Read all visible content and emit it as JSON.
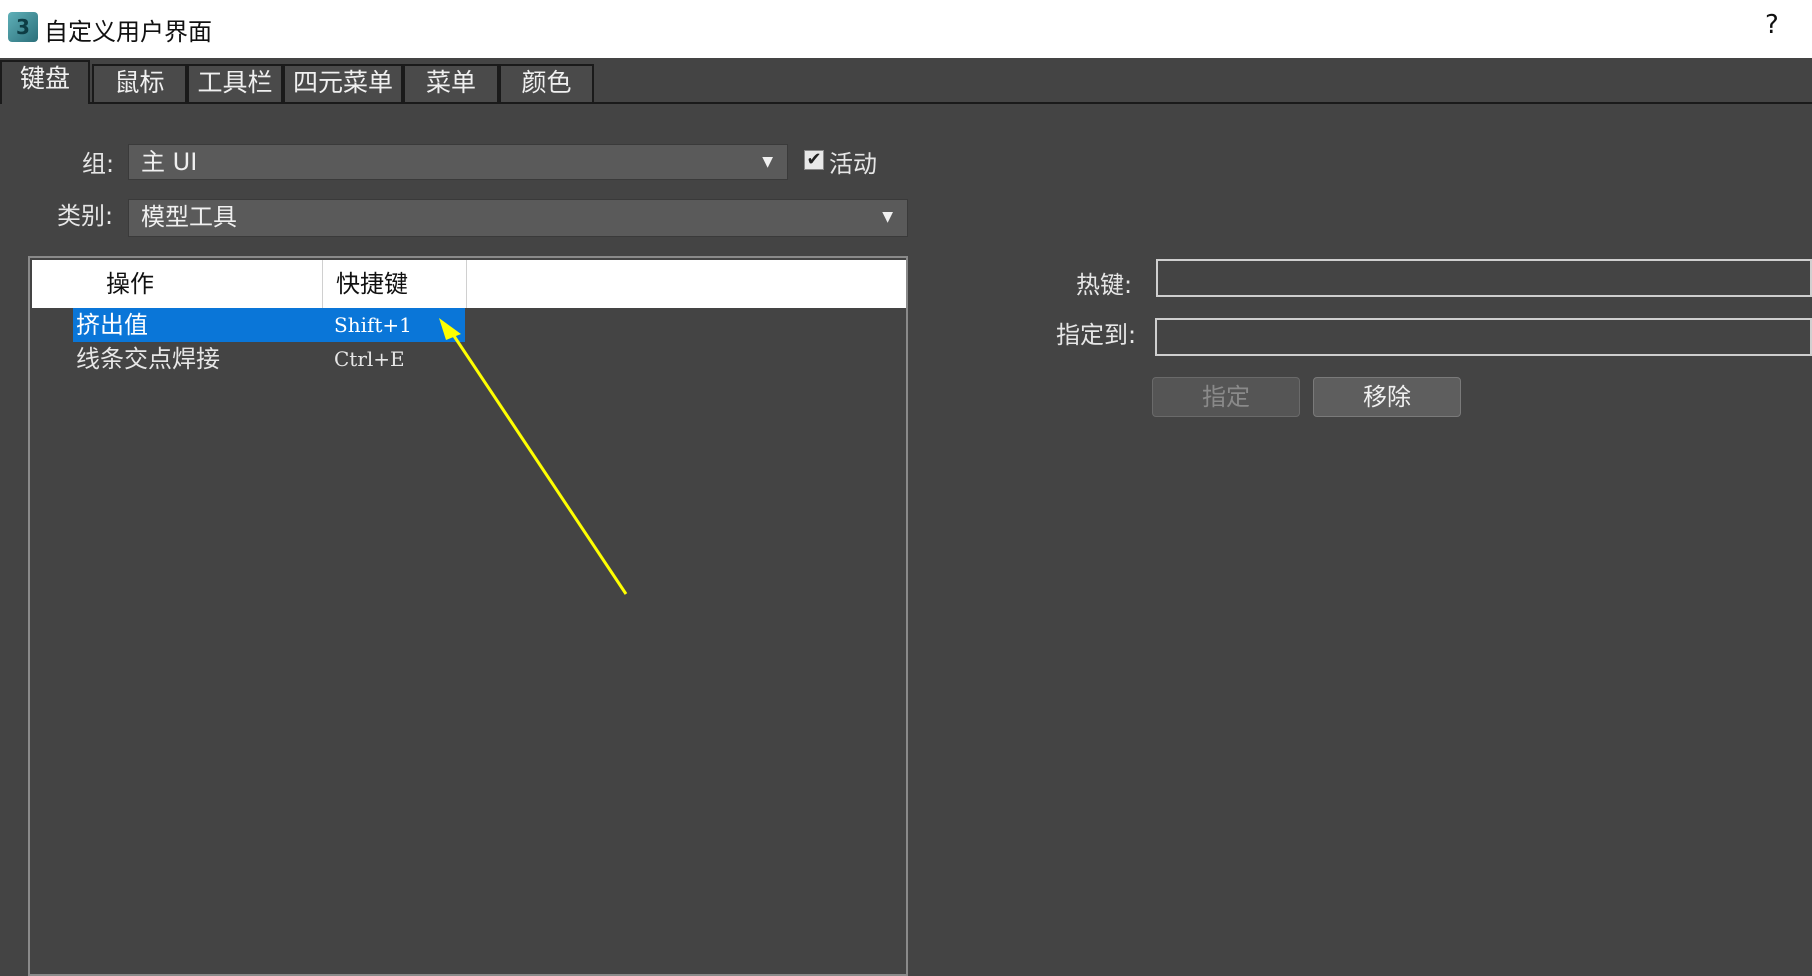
{
  "window": {
    "app_icon": "3",
    "title": "自定义用户界面",
    "help": "?"
  },
  "tabs": [
    {
      "label": "键盘",
      "active": true
    },
    {
      "label": "鼠标",
      "active": false
    },
    {
      "label": "工具栏",
      "active": false
    },
    {
      "label": "四元菜单",
      "active": false
    },
    {
      "label": "菜单",
      "active": false
    },
    {
      "label": "颜色",
      "active": false
    }
  ],
  "form": {
    "group_label": "组:",
    "group_value": "主 UI",
    "active_label": "活动",
    "active_checked": true,
    "category_label": "类别:",
    "category_value": "模型工具"
  },
  "list": {
    "columns": [
      "操作",
      "快捷键"
    ],
    "rows": [
      {
        "action": "挤出值",
        "shortcut": "Shift+1",
        "selected": true
      },
      {
        "action": "线条交点焊接",
        "shortcut": "Ctrl+E",
        "selected": false
      }
    ]
  },
  "hotkey_panel": {
    "hotkey_label": "热键:",
    "hotkey_value": "",
    "assign_to_label": "指定到:",
    "assign_to_value": "",
    "assign_button": "指定",
    "remove_button": "移除"
  },
  "annotation": {
    "arrow_color": "#ffff00"
  },
  "colors": {
    "background": "#444444",
    "selection": "#0a76d8",
    "titlebar": "#ffffff"
  }
}
